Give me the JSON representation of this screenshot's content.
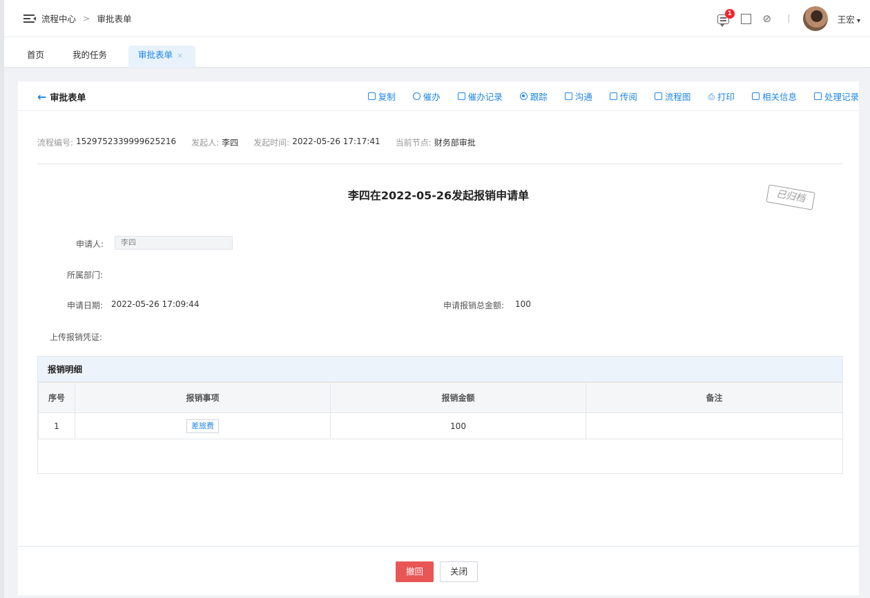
{
  "header": {
    "breadcrumb": [
      "流程中心",
      "审批表单"
    ],
    "breadcrumb_sep": ">",
    "message_badge": "1",
    "user_name": "王宏"
  },
  "tabs": [
    {
      "label": "首页"
    },
    {
      "label": "我的任务"
    },
    {
      "label": "审批表单",
      "close": "×"
    }
  ],
  "page": {
    "title": "审批表单",
    "actions": [
      {
        "label": "复制",
        "icon": "copy-icon"
      },
      {
        "label": "催办",
        "icon": "alarm-icon"
      },
      {
        "label": "催办记录",
        "icon": "record-icon"
      },
      {
        "label": "跟踪",
        "icon": "track-icon"
      },
      {
        "label": "沟通",
        "icon": "chat-icon"
      },
      {
        "label": "传阅",
        "icon": "circulate-icon"
      },
      {
        "label": "流程图",
        "icon": "flowchart-icon"
      },
      {
        "label": "打印",
        "icon": "print-icon"
      },
      {
        "label": "相关信息",
        "icon": "related-icon"
      },
      {
        "label": "处理记录",
        "icon": "history-icon"
      }
    ]
  },
  "meta": {
    "process_no_label": "流程编号:",
    "process_no": "1529752339999625216",
    "initiator_label": "发起人:",
    "initiator": "李四",
    "start_time_label": "发起时间:",
    "start_time": "2022-05-26 17:17:41",
    "node_label": "当前节点:",
    "node": "财务部审批"
  },
  "form": {
    "title": "李四在2022-05-26发起报销申请单",
    "stamp": "已归档",
    "applicant_label": "申请人:",
    "applicant": "李四",
    "dept_label": "所属部门:",
    "date_label": "申请日期:",
    "date": "2022-05-26 17:09:44",
    "total_label": "申请报销总金额:",
    "total": "100",
    "upload_label": "上传报销凭证:"
  },
  "detail": {
    "title": "报销明细",
    "columns": [
      "序号",
      "报销事项",
      "报销金额",
      "备注"
    ],
    "rows": [
      {
        "no": "1",
        "item": "差旅费",
        "amount": "100",
        "remark": ""
      }
    ]
  },
  "footer": {
    "revoke_label": "撤回",
    "close_label": "关闭",
    "revoke_color": "#e95656"
  }
}
